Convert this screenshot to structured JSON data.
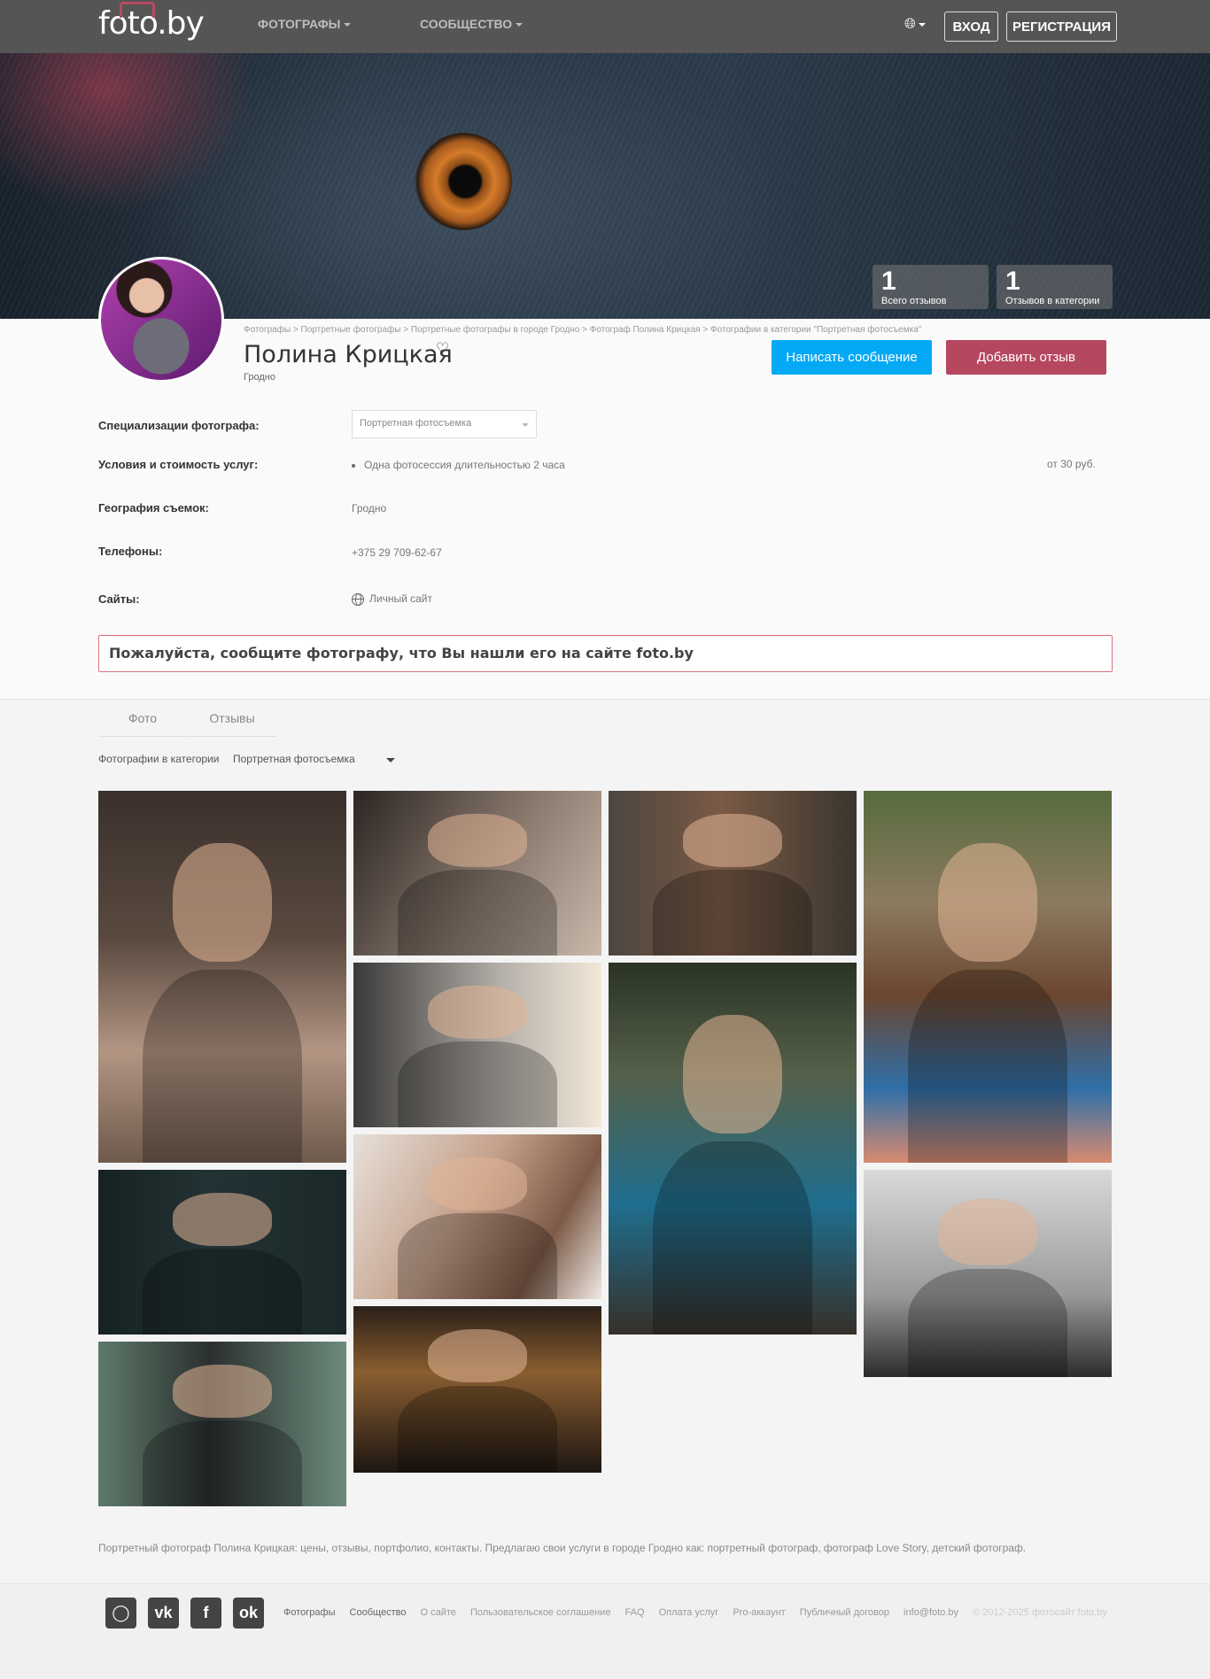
{
  "header": {
    "logo": "foto.by",
    "nav": [
      {
        "label": "ФОТОГРАФЫ"
      },
      {
        "label": "СООБЩЕСТВО"
      }
    ],
    "login": "ВХОД",
    "register": "РЕГИСТРАЦИЯ"
  },
  "stats": [
    {
      "value": "1",
      "label": "Всего отзывов"
    },
    {
      "value": "1",
      "label": "Отзывов в категории"
    }
  ],
  "breadcrumb": "Фотографы > Портретные фотографы > Портретные фотографы в городе Гродно > Фотограф Полина Крицкая > Фотографии в категории \"Портретная фотосъемка\"",
  "profile": {
    "name": "Полина Крицкая",
    "city": "Гродно",
    "message_button": "Написать сообщение",
    "review_button": "Добавить отзыв"
  },
  "fields": {
    "spec_label": "Специализации фотографа:",
    "spec_value": "Портретная фотосъемка",
    "terms_label": "Условия и стоимость услуг:",
    "terms_item": "Одна фотосессия длительностью 2 часа",
    "terms_price": "от 30 руб.",
    "geo_label": "География съемок:",
    "geo_value": "Гродно",
    "phones_label": "Телефоны:",
    "phones_value": "+375 29 709-62-67",
    "sites_label": "Сайты:",
    "sites_value": "Личный сайт"
  },
  "notice": "Пожалуйста, сообщите фотографу, что Вы нашли его на сайте foto.by",
  "tabs": [
    {
      "label": "Фото"
    },
    {
      "label": "Отзывы"
    }
  ],
  "filter": {
    "label": "Фотографии в категории",
    "value": "Портретная фотосъемка"
  },
  "seo_text": "Портретный фотограф Полина Крицкая: цены, отзывы, портфолио, контакты. Предлагаю свои услуги в городе Гродно как: портретный фотограф, фотограф Love Story, детский фотограф.",
  "footer": {
    "links": [
      "Фотографы",
      "Сообщество",
      "О сайте",
      "Пользовательское соглашение",
      "FAQ",
      "Оплата услуг",
      "Pro-аккаунт",
      "Публичный договор",
      "info@foto.by"
    ],
    "copyright": "© 2012-2025 фотосайт foto.by",
    "social_icons": [
      "instagram-icon",
      "vk-icon",
      "facebook-icon",
      "odnoklassniki-icon"
    ]
  }
}
